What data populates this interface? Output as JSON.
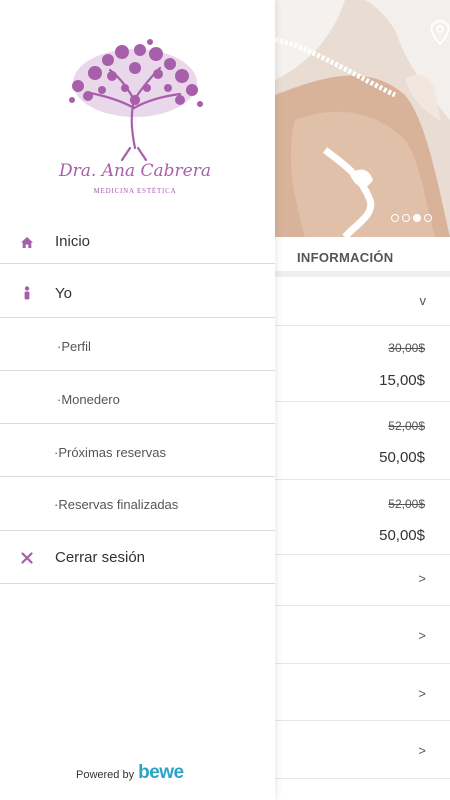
{
  "background": {
    "section_title": "INFORMACIÓN",
    "carousel": {
      "total": 4,
      "active": 3
    },
    "rows": [
      {
        "chevron": "v"
      },
      {
        "old_price": "30,00$",
        "new_price": "15,00$"
      },
      {
        "old_price": "52,00$",
        "new_price": "50,00$"
      },
      {
        "old_price": "52,00$",
        "new_price": "50,00$"
      },
      {
        "chevron": ">"
      },
      {
        "chevron": ">"
      },
      {
        "chevron": ">"
      },
      {
        "chevron": ">"
      }
    ]
  },
  "drawer": {
    "logo": {
      "name": "Dra. Ana Cabrera",
      "subtitle": "MEDICINA ESTÉTICA"
    },
    "menu": [
      {
        "label": "Inicio",
        "icon": "home-icon"
      },
      {
        "label": "Yo",
        "icon": "person-icon"
      },
      {
        "label": "·Perfil"
      },
      {
        "label": "·Monedero"
      },
      {
        "label": "·Próximas reservas"
      },
      {
        "label": "·Reservas finalizadas"
      },
      {
        "label": "Cerrar sesión",
        "icon": "close-icon"
      }
    ],
    "footer": {
      "powered_by": "Powered by",
      "brand": "bewe"
    }
  },
  "colors": {
    "accent": "#a75fac",
    "brand": "#2aa5c4",
    "divider": "#dcdcdc"
  }
}
